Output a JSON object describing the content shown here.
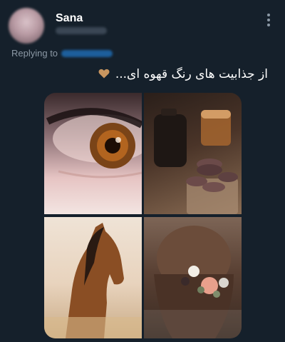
{
  "post": {
    "author_name": "Sana",
    "replying_label": "Replying to",
    "text": "از جذابیت های رنگ قهوه ای...",
    "heart_icon": "brown-heart-icon",
    "colors": {
      "background": "#15202b",
      "secondary_text": "#8b98a5",
      "link": "#1d9bf0",
      "heart": "#c8955f"
    }
  },
  "media": {
    "images": [
      "brown-eye-closeup",
      "coffee-and-macarons",
      "brown-horse",
      "brown-hair-with-flowers"
    ]
  }
}
